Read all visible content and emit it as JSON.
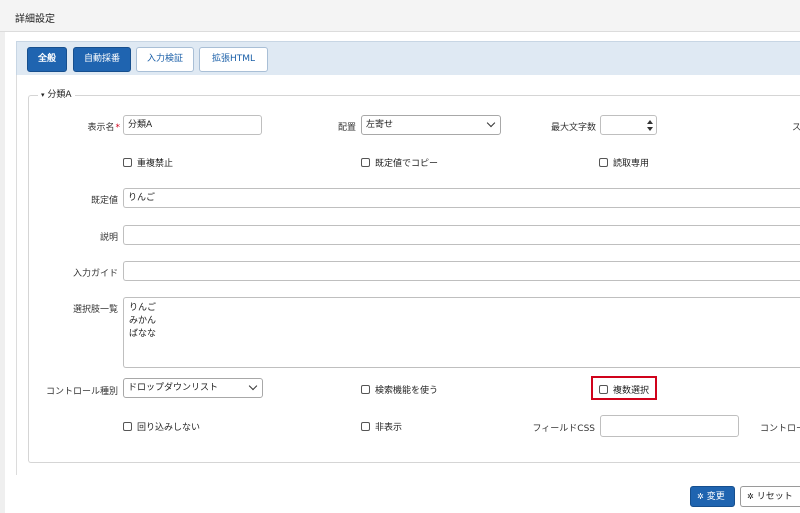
{
  "window": {
    "title": "詳細設定"
  },
  "tabs": [
    {
      "label": "全般",
      "active": true
    },
    {
      "label": "自動採番",
      "active": true
    },
    {
      "label": "入力検証",
      "active": false
    },
    {
      "label": "拡張HTML",
      "active": false
    }
  ],
  "section": {
    "legend": "分類A",
    "toggle_icon": "chevron-down-icon"
  },
  "fields": {
    "display_name": {
      "label": "表示名",
      "required_mark": "*",
      "value": "分類A"
    },
    "alignment": {
      "label": "配置",
      "value": "左寄せ"
    },
    "max_length": {
      "label": "最大文字数",
      "value": ""
    },
    "right_cut_label": "ス",
    "no_duplicates": {
      "label": "重複禁止",
      "checked": false
    },
    "copy_default": {
      "label": "既定値でコピー",
      "checked": false
    },
    "read_only": {
      "label": "読取専用",
      "checked": false
    },
    "default_value": {
      "label": "既定値",
      "value": "りんご"
    },
    "description": {
      "label": "説明",
      "value": ""
    },
    "input_guide": {
      "label": "入力ガイド",
      "value": ""
    },
    "choices": {
      "label": "選択肢一覧",
      "lines": [
        "りんご",
        "みかん",
        "ばなな"
      ]
    },
    "control_type": {
      "label": "コントロール種別",
      "value": "ドロップダウンリスト"
    },
    "use_search": {
      "label": "検索機能を使う",
      "checked": false
    },
    "multi_select": {
      "label": "複数選択",
      "checked": false
    },
    "no_wrap": {
      "label": "回り込みしない",
      "checked": false
    },
    "hidden": {
      "label": "非表示",
      "checked": false
    },
    "field_css": {
      "label": "フィールドCSS",
      "value": ""
    },
    "control_cut_label": "コントロー"
  },
  "footer": {
    "save_label": "変更",
    "reset_label": "リセット",
    "icon": "gear-icon"
  },
  "colors": {
    "primary": "#1f64b0",
    "highlight": "#d0021b",
    "tabbar": "#dfe9f3"
  }
}
